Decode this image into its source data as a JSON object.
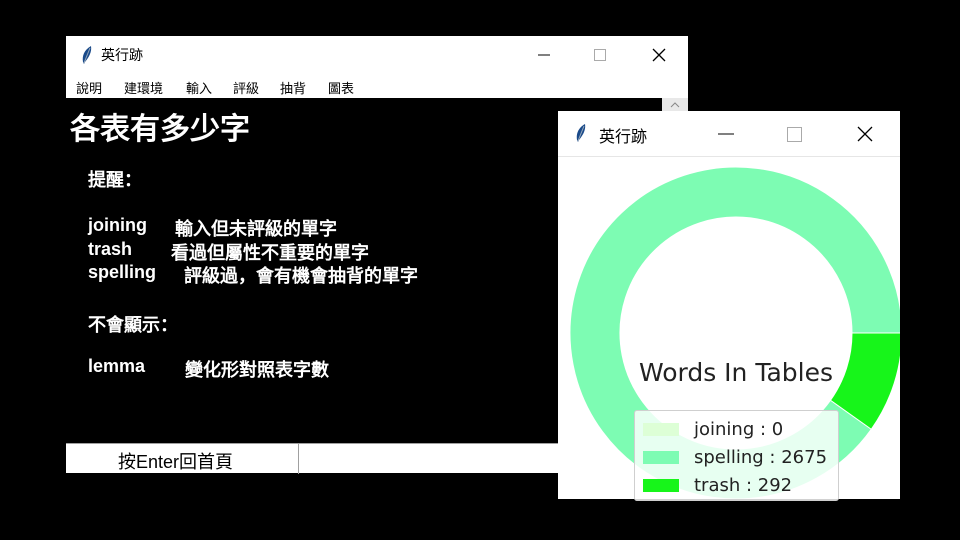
{
  "main_window": {
    "title": "英行跡",
    "menu": [
      "說明",
      "建環境",
      "輸入",
      "評級",
      "抽背",
      "圖表"
    ],
    "heading": "各表有多少字",
    "hint_label": "提醒：",
    "entries": [
      {
        "term": "joining",
        "desc": "輸入但未評級的單字"
      },
      {
        "term": "trash",
        "desc": "看過但屬性不重要的單字"
      },
      {
        "term": "spelling",
        "desc": "評級過，會有機會抽背的單字"
      }
    ],
    "hidden_label": "不會顯示：",
    "hidden_entry": {
      "term": "lemma",
      "desc": "變化形對照表字數"
    },
    "status": "按Enter回首頁"
  },
  "chart_window": {
    "title": "英行跡"
  },
  "chart_data": {
    "type": "pie",
    "style": "donut",
    "title": "Words In Tables",
    "slices": [
      {
        "label": "joining",
        "value": 0,
        "color": "#ddffd6"
      },
      {
        "label": "spelling",
        "value": 2675,
        "color": "#7dfcb3"
      },
      {
        "label": "trash",
        "value": 292,
        "color": "#17f51a"
      }
    ],
    "legend": [
      "joining : 0",
      "spelling : 2675",
      "trash : 292"
    ],
    "legend_position": "center"
  }
}
